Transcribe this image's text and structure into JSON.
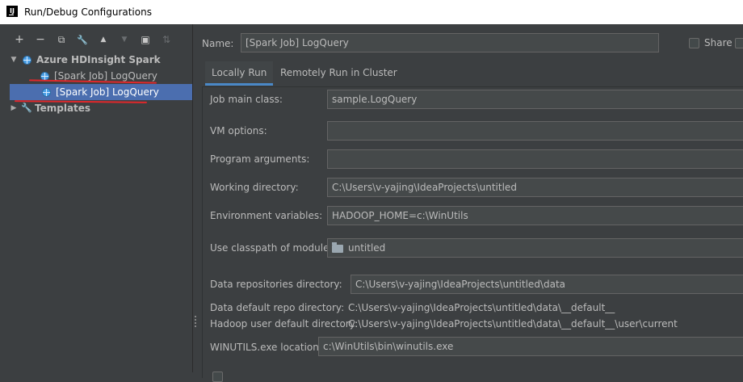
{
  "window": {
    "title": "Run/Debug Configurations",
    "app_icon_letter": "IJ"
  },
  "toolbar": {
    "buttons": [
      {
        "name": "add",
        "glyph": "+"
      },
      {
        "name": "remove",
        "glyph": "−"
      },
      {
        "name": "copy",
        "glyph": "⧉"
      },
      {
        "name": "edit-defaults",
        "glyph": "🔧"
      },
      {
        "name": "move-up",
        "glyph": "▲"
      },
      {
        "name": "move-down",
        "glyph": "▼"
      },
      {
        "name": "new-folder",
        "glyph": "▣"
      },
      {
        "name": "sort",
        "glyph": "⇅"
      }
    ]
  },
  "tree": {
    "group_label": "Azure HDInsight Spark",
    "items": [
      {
        "label": "[Spark Job] LogQuery"
      },
      {
        "label": "[Spark Job] LogQuery"
      }
    ],
    "templates_label": "Templates"
  },
  "config": {
    "name_label": "Name:",
    "name_value": "[Spark Job] LogQuery",
    "share_label": "Share"
  },
  "tabs": [
    {
      "label": "Locally Run",
      "active": true
    },
    {
      "label": "Remotely Run in Cluster",
      "active": false
    }
  ],
  "form": {
    "main_class_label": "Job main class:",
    "main_class_value": "sample.LogQuery",
    "vm_options_label": "VM options:",
    "vm_options_value": "",
    "program_args_label": "Program arguments:",
    "program_args_value": "",
    "working_dir_label": "Working directory:",
    "working_dir_value": "C:\\Users\\v-yajing\\IdeaProjects\\untitled",
    "env_vars_label": "Environment variables:",
    "env_vars_value": "HADOOP_HOME=c:\\WinUtils",
    "classpath_label": "Use classpath of module:",
    "classpath_value": "untitled",
    "data_repo_label": "Data repositories directory:",
    "data_repo_value": "C:\\Users\\v-yajing\\IdeaProjects\\untitled\\data",
    "default_repo_label": "Data default repo directory:",
    "default_repo_value": "C:\\Users\\v-yajing\\IdeaProjects\\untitled\\data\\__default__",
    "hadoop_user_label": "Hadoop user default directory:",
    "hadoop_user_value": "C:\\Users\\v-yajing\\IdeaProjects\\untitled\\data\\__default__\\user\\current",
    "winutils_label": "WINUTILS.exe location:",
    "winutils_value": "c:\\WinUtils\\bin\\winutils.exe"
  },
  "colors": {
    "background": "#3c3f41",
    "selection": "#4b6eaf",
    "field_bg": "#45494a",
    "annotation_red": "#e0282b",
    "tab_underline": "#4a88c7"
  }
}
